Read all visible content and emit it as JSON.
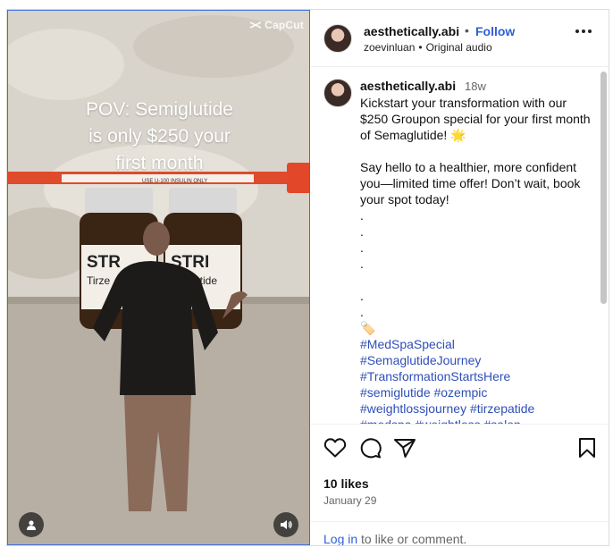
{
  "media": {
    "watermark": "CapCut",
    "overlay_lines": [
      "POV: Semiglutide",
      "is only $250 your",
      "first month"
    ],
    "vial_left_label": "STR",
    "vial_left_sub": "Tirze",
    "vial_right_label": "STRI",
    "vial_right_sub": "maglutide",
    "syringe_text": "USE U-100 INSULIN ONLY"
  },
  "header": {
    "username": "aesthetically.abi",
    "dot": "•",
    "follow_label": "Follow",
    "audio_user": "zoevinluan",
    "audio_sep": "•",
    "audio_label": "Original audio"
  },
  "caption": {
    "username": "aesthetically.abi",
    "time": "18w",
    "lines": [
      "Kickstart your transformation with our $250 Groupon special for your first month of Semaglutide! 🌟",
      "",
      "Say hello to a healthier, more confident you—limited time offer! Don’t wait, book your spot today!",
      ".",
      ".",
      ".",
      ".",
      "",
      ".",
      ".",
      "🏷️"
    ],
    "hashtags": [
      "#MedSpaSpecial",
      "#SemaglutideJourney",
      "#TransformationStartsHere",
      "#semiglutide #ozempic",
      "#weightlossjourney #tirzepatide",
      "#medspa #weightloss #salon"
    ]
  },
  "actions": {
    "likes": "10 likes",
    "date": "January 29",
    "login_link": "Log in",
    "login_rest": " to like or comment."
  },
  "icons": {
    "like": "heart-icon",
    "comment": "comment-icon",
    "share": "send-icon",
    "save": "bookmark-icon",
    "more": "more-options-icon",
    "user": "user-tag-icon",
    "sound": "volume-icon"
  }
}
